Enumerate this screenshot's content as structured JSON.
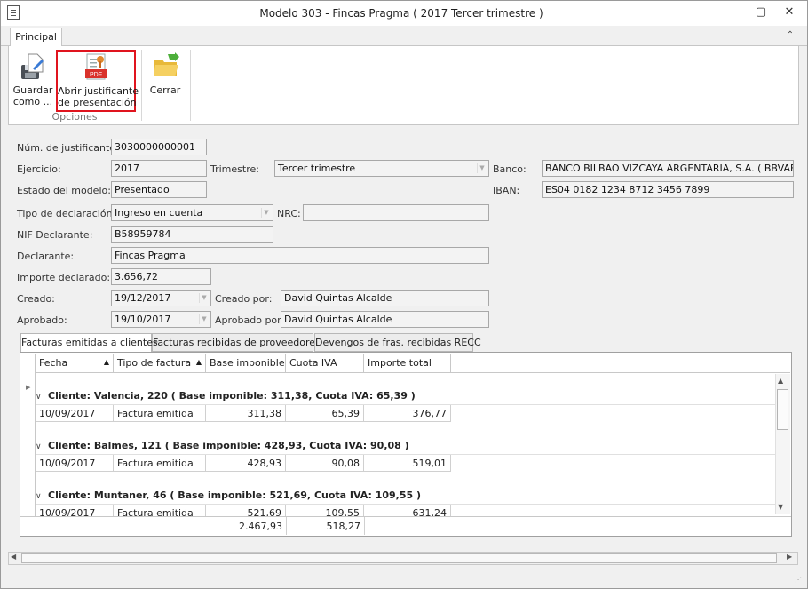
{
  "window": {
    "title": "Modelo 303 - Fincas Pragma ( 2017 Tercer trimestre )",
    "minimize": "—",
    "maximize": "▢",
    "close": "✕"
  },
  "ribbon": {
    "tab": "Principal",
    "buttons": [
      {
        "label": "Guardar\ncomo ...",
        "icon": "save-as-icon"
      },
      {
        "label": "Abrir justificante\nde presentación",
        "icon": "pdf-icon"
      },
      {
        "label": "Cerrar",
        "icon": "folder-close-icon"
      }
    ],
    "group_label": "Opciones",
    "pdf_text": "PDF"
  },
  "form": {
    "num_justificante": {
      "label": "Núm. de justificante:",
      "value": "3030000000001"
    },
    "ejercicio": {
      "label": "Ejercicio:",
      "value": "2017"
    },
    "trimestre": {
      "label": "Trimestre:",
      "value": "Tercer trimestre"
    },
    "banco": {
      "label": "Banco:",
      "value": "BANCO BILBAO VIZCAYA ARGENTARIA, S.A. ( BBVAESMM"
    },
    "estado": {
      "label": "Estado del modelo:",
      "value": "Presentado"
    },
    "iban": {
      "label": "IBAN:",
      "value": "ES04 0182 1234 8712 3456 7899"
    },
    "tipo_declaracion": {
      "label": "Tipo de declaración:",
      "value": "Ingreso en cuenta"
    },
    "nrc": {
      "label": "NRC:",
      "value": ""
    },
    "nif": {
      "label": "NIF Declarante:",
      "value": "B58959784"
    },
    "declarante": {
      "label": "Declarante:",
      "value": "Fincas Pragma"
    },
    "importe": {
      "label": "Importe declarado:",
      "value": "3.656,72"
    },
    "creado": {
      "label": "Creado:",
      "value": "19/12/2017"
    },
    "creado_por": {
      "label": "Creado por:",
      "value": "David Quintas Alcalde"
    },
    "aprobado": {
      "label": "Aprobado:",
      "value": "19/10/2017"
    },
    "aprobado_por": {
      "label": "Aprobado por:",
      "value": "David Quintas Alcalde"
    }
  },
  "tabs": [
    "Facturas emitidas a clientes",
    "Facturas recibidas de proveedores",
    "Devengos de fras. recibidas RECC"
  ],
  "grid": {
    "columns": [
      "Fecha",
      "Tipo de factura",
      "Base imponible",
      "Cuota IVA",
      "Importe total"
    ],
    "groups": [
      {
        "header": "Cliente: Valencia, 220 ( Base imponible: 311,38, Cuota IVA: 65,39 )",
        "row": [
          "10/09/2017",
          "Factura emitida",
          "311,38",
          "65,39",
          "376,77"
        ]
      },
      {
        "header": "Cliente: Balmes, 121 ( Base imponible: 428,93, Cuota IVA: 90,08 )",
        "row": [
          "10/09/2017",
          "Factura emitida",
          "428,93",
          "90,08",
          "519,01"
        ]
      },
      {
        "header": "Cliente: Muntaner, 46 ( Base imponible: 521,69, Cuota IVA: 109,55 )",
        "row": [
          "10/09/2017",
          "Factura emitida",
          "521,69",
          "109,55",
          "631,24"
        ]
      }
    ],
    "totals": {
      "base": "2.467,93",
      "cuota": "518,27"
    }
  },
  "colors": {
    "highlight": "#e0141e",
    "pdf_red": "#d9322b"
  }
}
